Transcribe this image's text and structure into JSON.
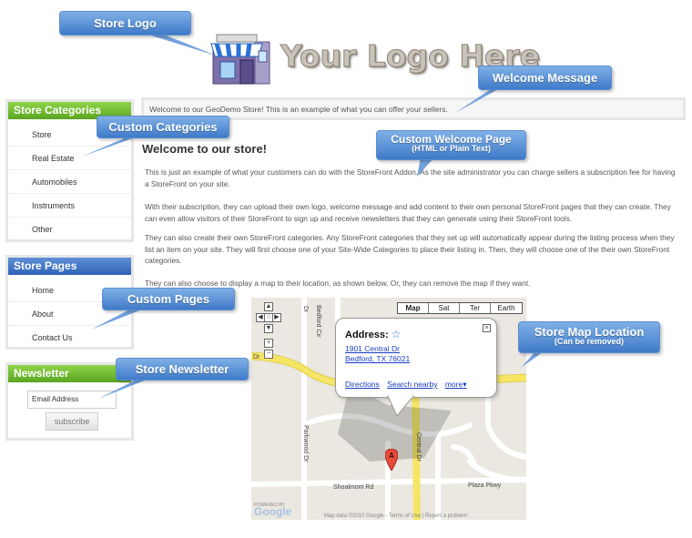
{
  "logo": {
    "text": "Your Logo Here"
  },
  "welcome_message": "Welcome to our GeoDemo Store! This is an example of what you can offer your sellers.",
  "categories": {
    "title": "Store Categories",
    "items": [
      "Store",
      "Real Estate",
      "Automobiles",
      "Instruments",
      "Other"
    ]
  },
  "pages": {
    "title": "Store Pages",
    "items": [
      "Home",
      "About",
      "Contact Us"
    ]
  },
  "newsletter": {
    "title": "Newsletter",
    "input_placeholder": "Email Address",
    "button_label": "subscribe"
  },
  "content": {
    "title": "Welcome to our store!",
    "paragraphs": [
      "This is just an example of what your customers can do with the StoreFront Addon. As the site administrator you can charge sellers a subscription fee for having a StoreFront on your site.",
      "With their subscription, they can upload their own logo, welcome message and add content to their own personal StoreFront pages that they can create. They can even allow visitors of their StoreFront to sign up and receive newsletters that they can generate using their StoreFront tools.",
      "They can also create their own StoreFront categories. Any StoreFront categories that they set up will automatically appear during the listing process when they list an item on your site. They will first choose one of your Site-Wide Categories to place their listing in. Then, they will choose one of the their own StoreFront categories.",
      "They can also choose to display a map to their location, as shown below. Or, they can remove the map if they want."
    ]
  },
  "map": {
    "types": [
      "Map",
      "Sat",
      "Ter",
      "Earth"
    ],
    "active_type": "Map",
    "address_label": "Address:",
    "address_line1": "1901 Central Dr",
    "address_line2": "Bedford, TX 76021",
    "links": [
      "Directions",
      "Search nearby",
      "more▾"
    ],
    "marker_label": "A",
    "roads": [
      "Bedford Cir",
      "Parkwood Dr",
      "Central Dr",
      "Shoalmont Rd",
      "Plaza Pkwy",
      "Dr"
    ],
    "powered_by": "POWERED BY",
    "google": "Google",
    "map_data": "Map data ©2010 Google - Terms of Use | Report a problem"
  },
  "callouts": {
    "store_logo": "Store Logo",
    "welcome_message": "Welcome Message",
    "custom_categories": "Custom Categories",
    "custom_welcome_page": "Custom Welcome Page",
    "custom_welcome_page_sub": "(HTML or Plain Text)",
    "custom_pages": "Custom Pages",
    "store_newsletter": "Store Newsletter",
    "store_map_location": "Store Map Location",
    "store_map_location_sub": "(Can be removed)"
  },
  "colors": {
    "green_header": "#5aa521",
    "blue_header": "#2f63b7",
    "callout_blue": "#3f7ac9",
    "link_blue": "#1a3ec2",
    "road_yellow": "#f5e565"
  }
}
